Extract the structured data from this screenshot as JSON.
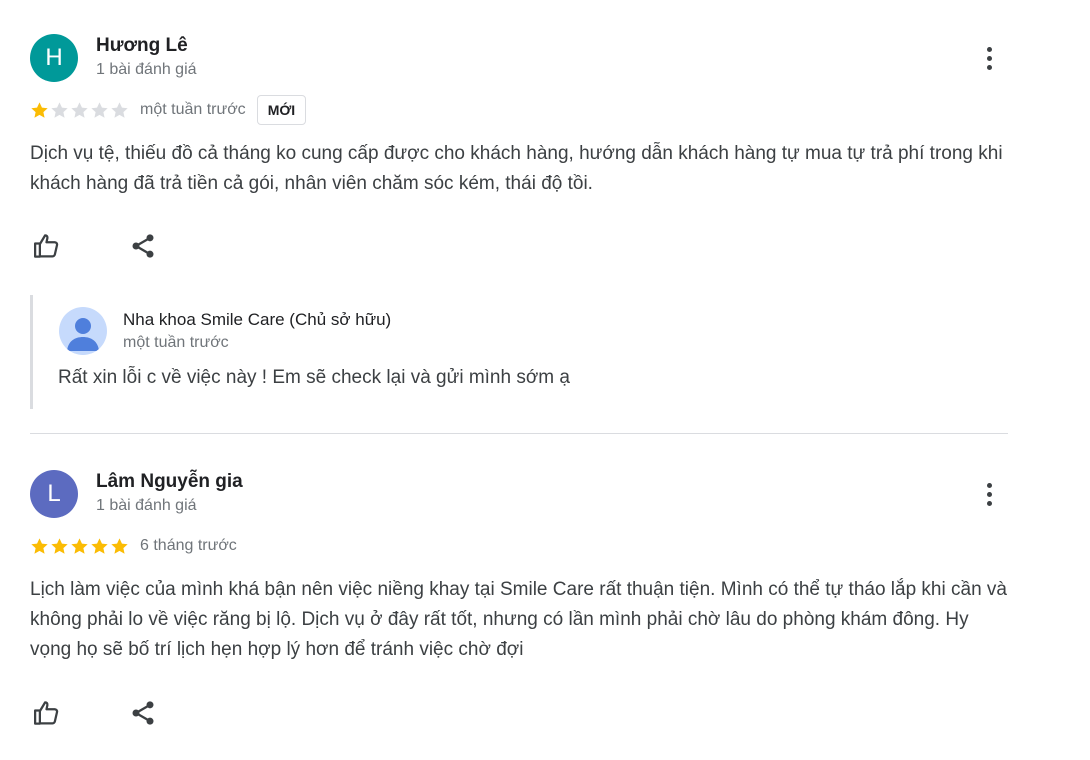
{
  "reviews": [
    {
      "avatar_letter": "H",
      "avatar_color": "#009999",
      "author": "Hương Lê",
      "review_count": "1 bài đánh giá",
      "rating": 1,
      "time": "một tuần trước",
      "badge": "MỚI",
      "text": "Dịch vụ tệ, thiếu đồ cả tháng ko cung cấp được cho khách hàng, hướng dẫn khách hàng tự mua tự trả phí trong khi khách hàng đã trả tiền cả gói, nhân viên chăm sóc kém, thái độ tồi.",
      "icons": {
        "like": "thumbs-up-icon",
        "share": "share-icon",
        "menu": "more-vert-icon"
      },
      "owner_reply": {
        "name": "Nha khoa Smile Care (Chủ sở hữu)",
        "time": "một tuần trước",
        "text": "Rất xin lỗi c về việc này ! Em sẽ check lại và gửi mình sớm ạ",
        "avatar_icon": "default-profile-icon"
      }
    },
    {
      "avatar_letter": "L",
      "avatar_color": "#5c6bc0",
      "author": "Lâm Nguyễn gia",
      "review_count": "1 bài đánh giá",
      "rating": 5,
      "time": "6 tháng trước",
      "text": "Lịch làm việc của mình khá bận nên việc niềng khay tại Smile Care rất thuận tiện. Mình có thể tự tháo lắp khi cần và không phải lo về việc răng bị lộ. Dịch vụ ở đây rất tốt, nhưng có lần mình phải chờ lâu do phòng khám đông. Hy vọng họ sẽ bố trí lịch hẹn hợp lý hơn để tránh việc chờ đợi",
      "icons": {
        "like": "thumbs-up-icon",
        "share": "share-icon",
        "menu": "more-vert-icon"
      }
    }
  ],
  "colors": {
    "star_filled": "#fbbc04",
    "star_empty": "#dadce0",
    "muted_text": "#70757a",
    "body_text": "#3c4043"
  }
}
